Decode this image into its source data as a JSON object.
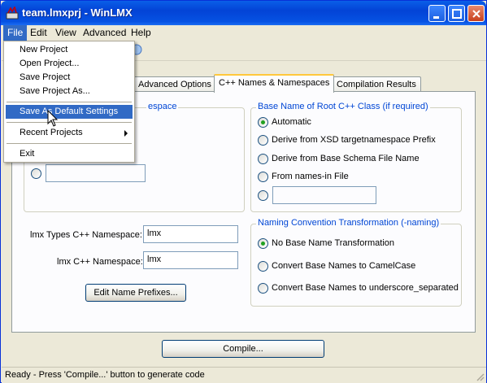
{
  "window": {
    "title": "team.lmxprj - WinLMX",
    "icon": "winlmx-app-icon"
  },
  "menubar": {
    "items": [
      "File",
      "Edit",
      "View",
      "Advanced",
      "Help"
    ],
    "active": "File"
  },
  "file_menu": {
    "items": [
      {
        "label": "New Project"
      },
      {
        "label": "Open Project..."
      },
      {
        "label": "Save Project"
      },
      {
        "label": "Save Project As..."
      },
      {
        "label": "Save As Default Settings",
        "highlighted": true
      },
      {
        "label": "Recent Projects",
        "submenu": true
      },
      {
        "label": "Exit"
      }
    ]
  },
  "tabs": {
    "items": [
      "Advanced Options",
      "C++ Names & Namespaces",
      "Compilation Results"
    ],
    "selected": "C++ Names & Namespaces"
  },
  "left_group": {
    "legend_fragment": "espace",
    "text_value": ""
  },
  "base_name_group": {
    "legend": "Base Name of Root C++ Class (if required)",
    "options": [
      "Automatic",
      "Derive from XSD targetnamespace Prefix",
      "Derive from Base Schema File Name",
      "From names-in File"
    ],
    "selected": "Automatic",
    "custom_value": ""
  },
  "namespaces": {
    "lmx_types_label": "lmx Types C++ Namespace:",
    "lmx_types_value": "lmx",
    "lmx_label": "lmx C++ Namespace:",
    "lmx_value": "lmx",
    "edit_prefixes_button": "Edit Name Prefixes..."
  },
  "naming_group": {
    "legend": "Naming Convention Transformation (-naming)",
    "options": [
      "No Base Name Transformation",
      "Convert Base Names to CamelCase",
      "Convert Base Names to underscore_separated"
    ],
    "selected": "No Base Name Transformation"
  },
  "compile_button": "Compile...",
  "status": {
    "text": "Ready - Press 'Compile...' button to generate code"
  },
  "colors": {
    "titlebar": "#0a5fe8",
    "menu_highlight": "#316ac5",
    "group_legend": "#0046d5",
    "window_bg": "#ece9d8",
    "panel_bg": "#fcfcfe"
  }
}
